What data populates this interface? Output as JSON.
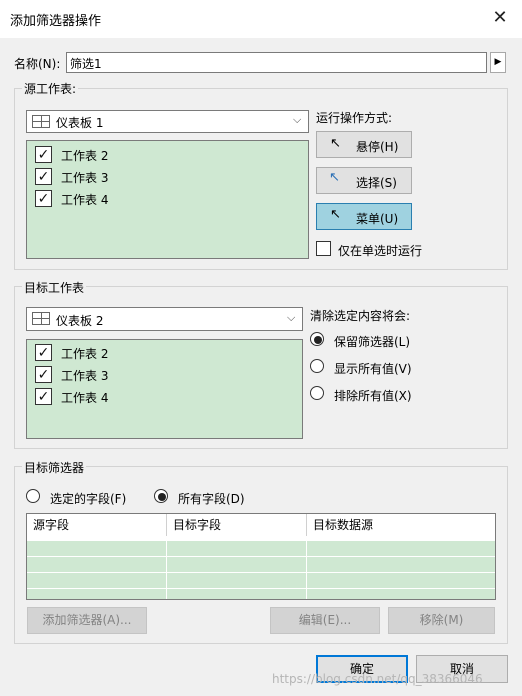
{
  "dialog": {
    "title": "添加筛选器操作",
    "name_label": "名称(N):",
    "name_value": "筛选1",
    "source_group": {
      "title": "源工作表:",
      "combo_value": "仪表板 1",
      "items": [
        {
          "label": "工作表 2",
          "checked": true
        },
        {
          "label": "工作表 3",
          "checked": true
        },
        {
          "label": "工作表 4",
          "checked": true
        }
      ],
      "run_label": "运行操作方式:",
      "run_buttons": [
        "悬停(H)",
        "选择(S)",
        "菜单(U)"
      ],
      "only_single_label": "仅在单选时运行"
    },
    "target_group": {
      "title": "目标工作表",
      "combo_value": "仪表板 2",
      "items": [
        {
          "label": "工作表 2",
          "checked": true
        },
        {
          "label": "工作表 3",
          "checked": true
        },
        {
          "label": "工作表 4",
          "checked": true
        }
      ],
      "clear_label": "清除选定内容将会:",
      "clear_options": [
        "保留筛选器(L)",
        "显示所有值(V)",
        "排除所有值(X)"
      ],
      "clear_selected": "保留筛选器(L)"
    },
    "filter_group": {
      "title": "目标筛选器",
      "radio_options": [
        "选定的字段(F)",
        "所有字段(D)"
      ],
      "radio_selected": "所有字段(D)",
      "columns": [
        "源字段",
        "目标字段",
        "目标数据源"
      ],
      "add_button": "添加筛选器(A)...",
      "edit_button": "编辑(E)...",
      "remove_button": "移除(M)"
    },
    "ok_button": "确定",
    "cancel_button": "取消",
    "watermark": "https://blog.csdn.net/qq_38366046"
  },
  "colors": {
    "list_bg": "#cfe8d2",
    "active_button": "#9fd2e0",
    "dialog_bg": "#f0f0f0"
  }
}
